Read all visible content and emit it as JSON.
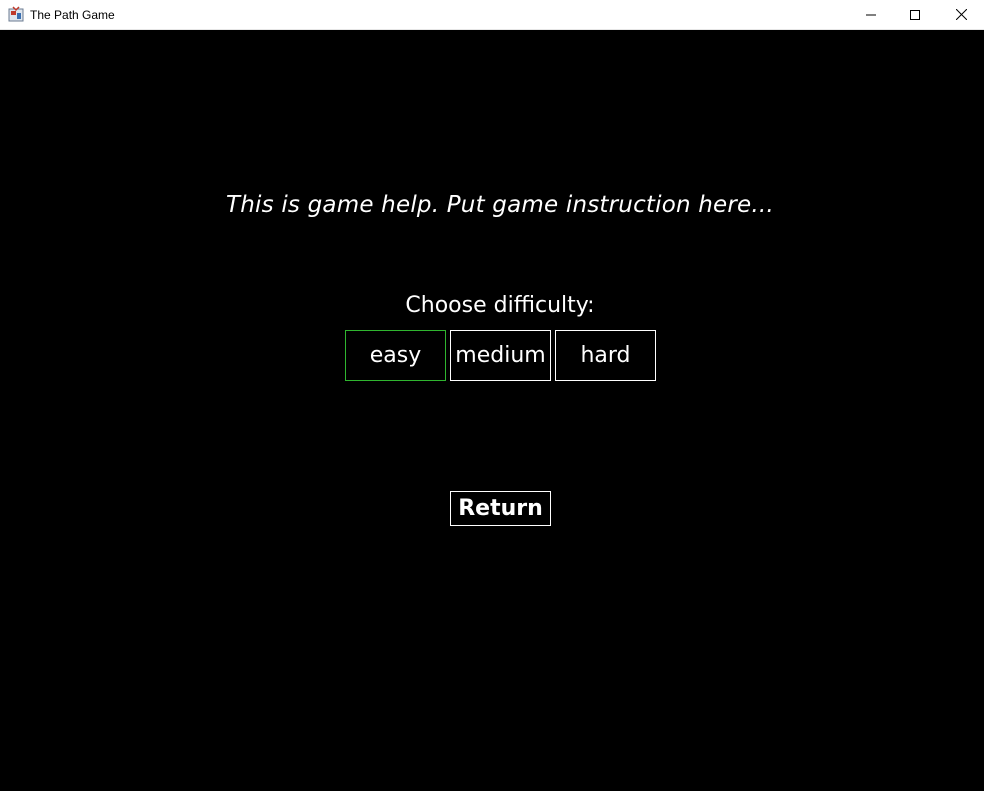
{
  "window": {
    "title": "The Path Game",
    "icon": "java-app-icon"
  },
  "controls": {
    "minimize_icon": "minimize-icon",
    "maximize_icon": "maximize-icon",
    "close_icon": "close-icon"
  },
  "help": {
    "text": "This is game help. Put game instruction here..."
  },
  "difficulty": {
    "label": "Choose difficulty:",
    "options": [
      {
        "label": "easy",
        "selected": true
      },
      {
        "label": "medium",
        "selected": false
      },
      {
        "label": "hard",
        "selected": false
      }
    ],
    "selected_color": "#2fb52f"
  },
  "actions": {
    "return_label": "Return"
  },
  "colors": {
    "background": "#000000",
    "text": "#ffffff",
    "border": "#ffffff"
  }
}
